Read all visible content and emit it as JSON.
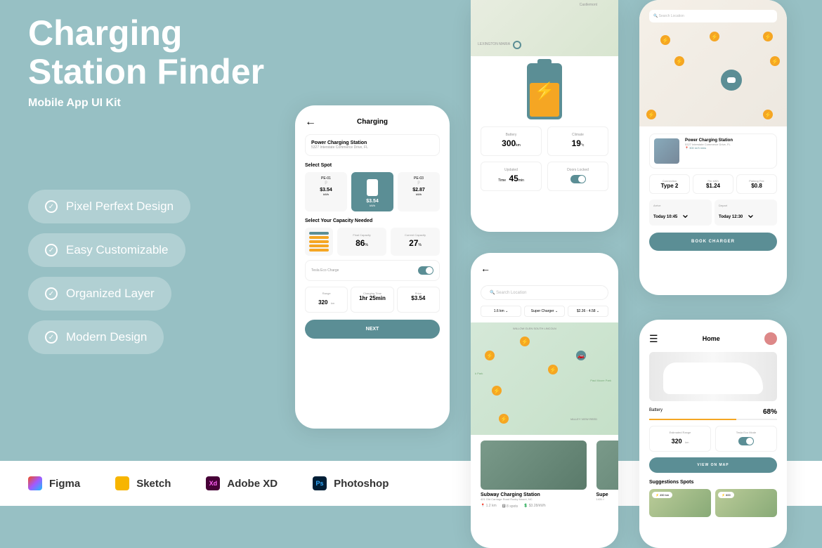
{
  "hero": {
    "title1": "Charging",
    "title2": "Station Finder",
    "subtitle": "Mobile App UI Kit"
  },
  "features": [
    "Pixel Perfext Design",
    "Easy Customizable",
    "Organized Layer",
    "Modern Design"
  ],
  "brands": [
    "Figma",
    "Sketch",
    "Adobe XD",
    "Photoshop"
  ],
  "brand_colors": [
    "#a259ff",
    "#f7b500",
    "#470137",
    "#001e36"
  ],
  "p1": {
    "title": "Charging",
    "station_name": "Power Charging Station",
    "station_addr": "5327 Interstate Commerce Drive, FL",
    "select_spot": "Select Spot",
    "spots": [
      {
        "id": "PE-01",
        "price": "$3.54",
        "unit": "kWh"
      },
      {
        "id": "",
        "price": "$3.54",
        "unit": "kWh"
      },
      {
        "id": "PE-03",
        "price": "$2.87",
        "unit": "kWh"
      }
    ],
    "select_cap": "Select Your Capacity Needed",
    "final_lbl": "Final Capacity",
    "final_val": "86",
    "pct": "%",
    "curr_lbl": "Current Capacity",
    "curr_val": "27",
    "eco_lbl": "Tesla Eco Charge",
    "range_lbl": "Range",
    "range_val": "320",
    "range_unit": "km",
    "time_lbl": "Charging Time",
    "time_val": "1hr 25min",
    "price_lbl": "Price",
    "price_val": "$3.54",
    "next_btn": "NEXT"
  },
  "p2": {
    "map_lbl1": "Castlemont",
    "map_lbl2": "LEXINGTON MARIA",
    "batt_lbl": "Battery",
    "batt_val": "300",
    "batt_unit": "km",
    "climate_lbl": "Climate",
    "climate_val": "19",
    "climate_unit": "°c",
    "updated_lbl": "Updated",
    "updated_val": "45",
    "updated_unit": "min",
    "time_lbl": "Time",
    "doors_lbl": "Doors Locked"
  },
  "p3": {
    "search": "Search Location",
    "filter1": "1.6 km",
    "filter2": "Super Charger",
    "filter3": "$2.36 - 4.58",
    "area1": "WILLOW GLEN SOUTH LINCOLN",
    "area2": "k Park",
    "area3": "Paul Moore Park",
    "area4": "VALLEY VIEW REED",
    "station_name": "Subway Charging Station",
    "station_addr": "421 Old Carriage Road Rocky Mount, NC",
    "meta1": "1.2 km",
    "meta2": "8 spots",
    "meta3": "$3.28/kWh",
    "next_name": "Supe",
    "next_addr": "1431 f"
  },
  "p4": {
    "search": "Search Location",
    "station_name": "Power Charging Station",
    "station_addr": "5327 Interstate Commerce Drive, FL",
    "station_dist": "300 m/3 mins",
    "conn_lbl": "Connection",
    "conn_val": "Type 2",
    "kwh_lbl": "Per kWh",
    "kwh_val": "$1.24",
    "park_lbl": "Parking Fee",
    "park_val": "$0.8",
    "arrive_lbl": "Arrive",
    "arrive_val": "Today 10:45",
    "depart_lbl": "Depart",
    "depart_val": "Today 12:30",
    "book_btn": "BOOK CHARGER"
  },
  "p5": {
    "title": "Home",
    "batt_lbl": "Battery",
    "batt_pct": "68%",
    "range_lbl": "Estimated Range",
    "range_val": "320",
    "range_unit": "km",
    "eco_lbl": "Tesla Eco Mode",
    "view_btn": "VIEW ON MAP",
    "sugg_title": "Suggestions Spots",
    "badge1": "450 km",
    "badge2": "600"
  }
}
